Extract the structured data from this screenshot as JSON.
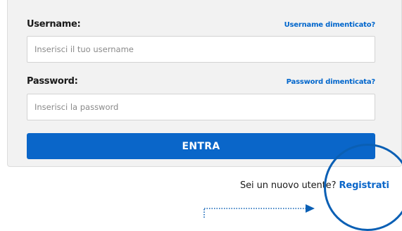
{
  "login": {
    "username_label": "Username:",
    "username_forgot": "Username dimenticato?",
    "username_placeholder": "Inserisci il tuo username",
    "username_value": "",
    "password_label": "Password:",
    "password_forgot": "Password dimenticata?",
    "password_placeholder": "Inserisci la password",
    "password_value": "",
    "submit_label": "ENTRA"
  },
  "register": {
    "question": "Sei un nuovo utente?",
    "link_label": "Registrati"
  },
  "colors": {
    "accent": "#0a66c9",
    "panel_background": "#f2f2f2",
    "annotation": "#0a5fb4"
  },
  "annotation": {
    "highlight_icon": "circle-highlight",
    "pointer_icon": "dotted-arrow-icon"
  }
}
